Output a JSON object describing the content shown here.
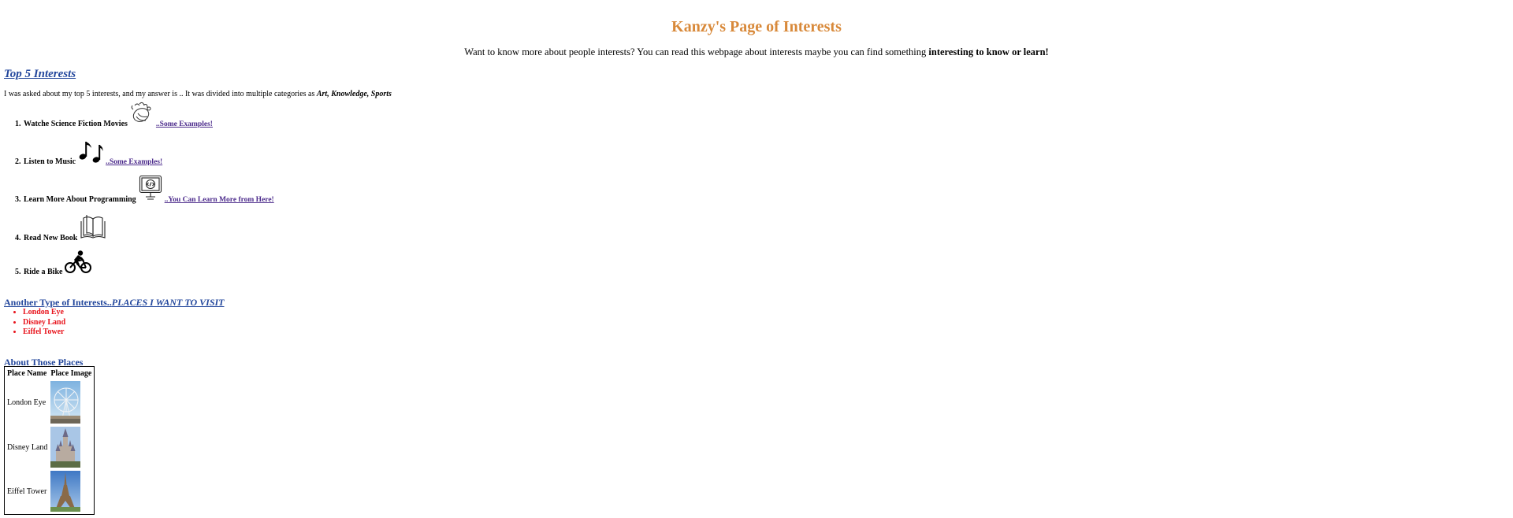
{
  "page": {
    "title": "Kanzy's Page of Interests",
    "intro_plain": "Want to know more about people interests? You can read this webpage about interests maybe you can find something ",
    "intro_bold": "interesting to know or learn!"
  },
  "top5": {
    "heading": "Top 5 Interests",
    "intro_plain": "I was asked about my top 5 interests, and my answer is .. It was divided into multiple categories as ",
    "intro_categories": "Art, Knowledge, Sports",
    "items": [
      {
        "number": "1.",
        "label": "Watche Science Fiction Movies",
        "icon": "alien-hand-icon",
        "link": "..Some Examples!"
      },
      {
        "number": "2.",
        "label": "Listen to Music",
        "icon": "music-notes-icon",
        "link": "..Some Examples!"
      },
      {
        "number": "3.",
        "label": "Learn More About Programming",
        "icon": "computer-code-icon",
        "link": "..You Can Learn More from Here!"
      },
      {
        "number": "4.",
        "label": "Read New Book",
        "icon": "open-book-icon",
        "link": ""
      },
      {
        "number": "5.",
        "label": "Ride a Bike",
        "icon": "cyclist-icon",
        "link": ""
      }
    ]
  },
  "places": {
    "heading_plain": "Another Type of Interests..",
    "heading_italic": "PLACES I WANT TO VISIT",
    "items": [
      "London Eye",
      "Disney Land",
      "Eiffel Tower"
    ]
  },
  "about": {
    "heading": "About Those Places",
    "columns": [
      "Place Name",
      "Place Image"
    ],
    "rows": [
      {
        "name": "London Eye",
        "image": "london-eye-photo"
      },
      {
        "name": "Disney Land",
        "image": "disney-castle-photo"
      },
      {
        "name": "Eiffel Tower",
        "image": "eiffel-tower-photo"
      }
    ]
  },
  "colors": {
    "title": "#d8893a",
    "heading": "#23479c",
    "link": "#4b2a8b",
    "places_list": "#e8131b"
  }
}
